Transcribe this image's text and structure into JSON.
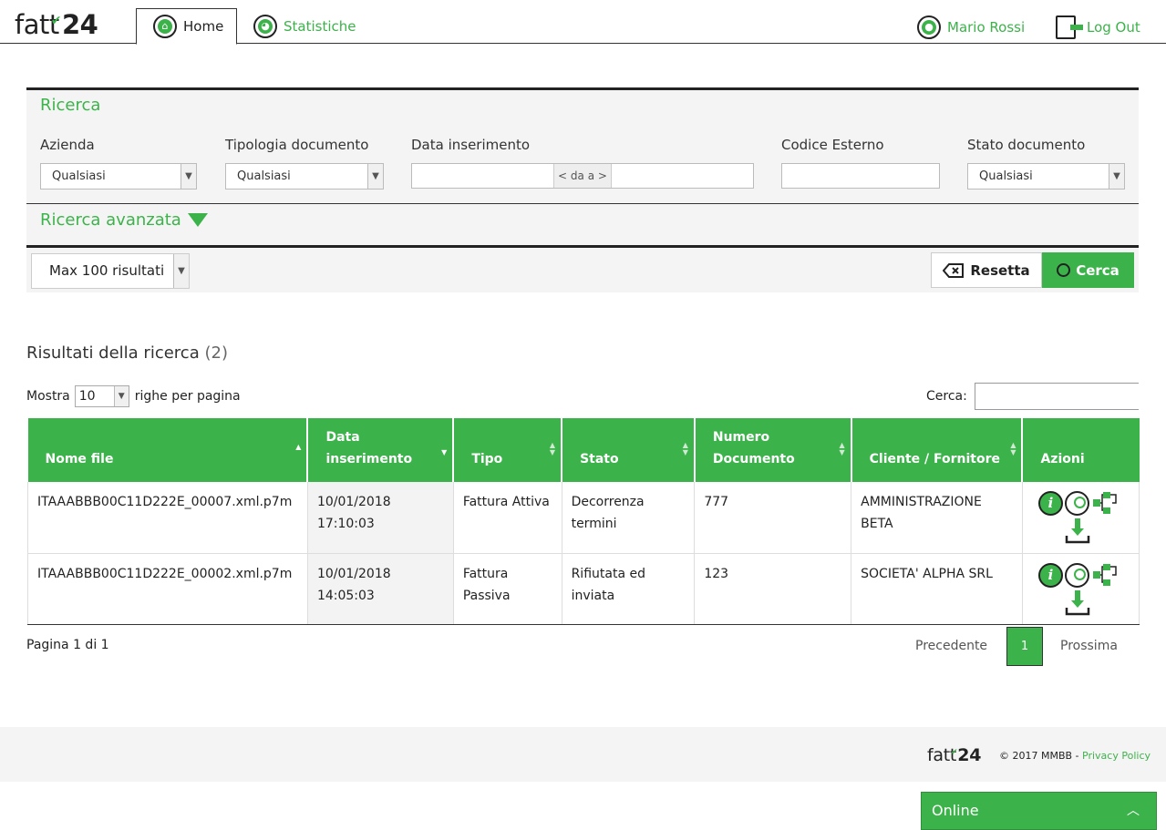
{
  "header": {
    "logo_prefix": "fatt",
    "logo_suffix": "24",
    "tabs": [
      {
        "label": "Home",
        "icon": "home-icon"
      },
      {
        "label": "Statistiche",
        "icon": "pie-chart-icon"
      }
    ],
    "user_name": "Mario Rossi",
    "logout_label": "Log Out"
  },
  "search": {
    "title": "Ricerca",
    "azienda_label": "Azienda",
    "azienda_value": "Qualsiasi",
    "tipologia_label": "Tipologia documento",
    "tipologia_value": "Qualsiasi",
    "data_label": "Data inserimento",
    "data_separator": "< da a >",
    "codice_label": "Codice Esterno",
    "stato_label": "Stato documento",
    "stato_value": "Qualsiasi",
    "advanced_label": "Ricerca avanzata",
    "max_results": "Max 100 risultati",
    "reset_label": "Resetta",
    "search_label": "Cerca"
  },
  "results": {
    "title": "Risultati della ricerca",
    "count": "(2)",
    "show_label": "Mostra",
    "page_size": "10",
    "rows_label": "righe per pagina",
    "filter_label": "Cerca:",
    "columns": [
      "Nome file",
      "Data inserimento",
      "Tipo",
      "Stato",
      "Numero Documento",
      "Cliente / Fornitore",
      "Azioni"
    ],
    "rows": [
      {
        "nome_file": "ITAAABBB00C11D222E_00007.xml.p7m",
        "data": "10/01/2018 17:10:03",
        "tipo": "Fattura Attiva",
        "stato": "Decorrenza termini",
        "numero": "777",
        "cliente": "AMMINISTRAZIONE BETA"
      },
      {
        "nome_file": "ITAAABBB00C11D222E_00002.xml.p7m",
        "data": "10/01/2018 14:05:03",
        "tipo": "Fattura Passiva",
        "stato": "Rifiutata ed inviata",
        "numero": "123",
        "cliente": "SOCIETA' ALPHA SRL"
      }
    ],
    "page_info": "Pagina 1 di 1",
    "prev_label": "Precedente",
    "current_page": "1",
    "next_label": "Prossima"
  },
  "footer": {
    "logo_prefix": "fatt",
    "logo_suffix": "24",
    "copyright": "© 2017 MMBB - ",
    "privacy_label": "Privacy Policy"
  },
  "chat": {
    "status_label": "Online"
  },
  "colors": {
    "accent": "#3cb34a",
    "panel_bg": "#f4f4f4"
  }
}
